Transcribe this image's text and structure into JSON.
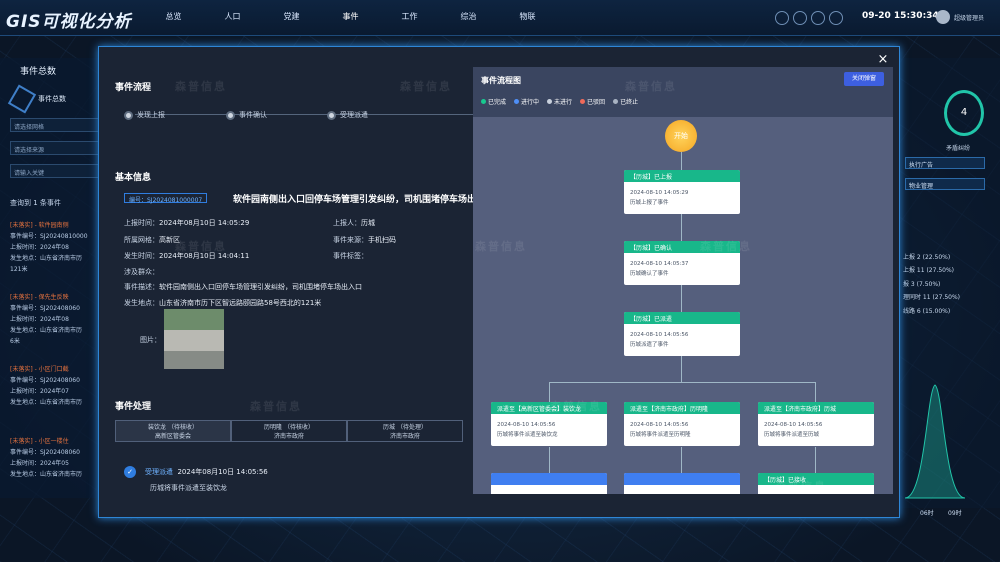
{
  "app": {
    "title": "GIS可视化分析"
  },
  "nav": [
    "总览",
    "人口",
    "党建",
    "事件",
    "工作",
    "综治",
    "物联"
  ],
  "header": {
    "clock": "09-20 15:30:34",
    "user": "超级管理员"
  },
  "left": {
    "title": "事件总数",
    "total_label": "事件总数",
    "filters": [
      "请选择网格",
      "请选择来源",
      "请输入关键"
    ],
    "count": "查询到 1 条事件",
    "events": [
      {
        "title": "[未落实] - 软件园南侧",
        "code": "事件编号：SJ20240810000",
        "time": "上报时间：2024年08",
        "addr": "发生地点：山东省济南市历",
        "extra": "121米"
      },
      {
        "title": "[未落实] - 保先生反映",
        "code": "事件编号：SJ202408060",
        "time": "上报时间：2024年08",
        "addr": "发生地点：山东省济南市历",
        "extra": "6米"
      },
      {
        "title": "[未落实] - 小区门口截",
        "code": "事件编号：SJ202408060",
        "time": "上报时间：2024年07",
        "addr": "发生地点：山东省济南市历",
        "extra": ""
      },
      {
        "title": "[未落实] - 小区一楼住",
        "code": "事件编号：SJ202408060",
        "time": "上报时间：2024年05",
        "addr": "发生地点：山东省济南市历",
        "extra": ""
      }
    ]
  },
  "right": {
    "gauge": "4",
    "gauge_label": "矛盾纠纷",
    "boxes": [
      "执行广告",
      "物业管理"
    ],
    "stats": [
      "上报 2 (22.50%)",
      "上报 11 (27.50%)",
      "报 3 (7.50%)",
      "理同时 11 (27.50%)",
      "线路 6 (15.00%)"
    ],
    "x_labels": [
      "06时",
      "09时"
    ]
  },
  "modal": {
    "close": "×",
    "process_title": "事件流程",
    "steps": [
      "发现上报",
      "事件确认",
      "受理派遣"
    ],
    "basic_title": "基本信息",
    "code": "编号：SJ2024081000007",
    "event_title": "软件园南侧出入口回停车场管理引发纠纷，司机围堵停车场出入",
    "info": {
      "report_time_label": "上报时间：",
      "report_time": "2024年08月10日 14:05:29",
      "reporter_label": "上报人：",
      "reporter": "历城",
      "grid_label": "所属网格：",
      "grid": "高新区",
      "source_label": "事件来源：",
      "source": "手机扫码",
      "occur_time_label": "发生时间：",
      "occur_time": "2024年08月10日 14:04:11",
      "tag_label": "事件标签：",
      "tag": "",
      "people_label": "涉及群众：",
      "people": "",
      "desc_label": "事件描述：",
      "desc": "软件园南侧出入口回停车场管理引发纠纷，司机围堵停车场出入口",
      "place_label": "发生地点：",
      "place": "山东省济南市历下区智远路颐园路58号西北的121米",
      "photo_label": "图片："
    },
    "handle_title": "事件处理",
    "tabs": [
      {
        "line1": "装饮龙 （待核收）",
        "line2": "高新区管委会"
      },
      {
        "line1": "历明隆 （待核收）",
        "line2": "济南市政府"
      },
      {
        "line1": "历城 （待处理）",
        "line2": "济南市政府"
      }
    ],
    "log": {
      "who": "受理派遣",
      "time": "2024年08月10日 14:05:56",
      "text": "历城将事件派遣至装饮龙"
    }
  },
  "flow": {
    "title": "事件流程图",
    "close_btn": "关闭弹窗",
    "legend": [
      {
        "label": "已完成",
        "color": "#18c98f"
      },
      {
        "label": "进行中",
        "color": "#4f8ff7"
      },
      {
        "label": "未进行",
        "color": "#c8d0dc"
      },
      {
        "label": "已驳回",
        "color": "#f06a5a"
      },
      {
        "label": "已终止",
        "color": "#a9b3c3"
      }
    ],
    "start": "开始",
    "nodes": [
      {
        "head": "【历城】已上报",
        "time": "2024-08-10 14:05:29",
        "text": "历城上报了事件"
      },
      {
        "head": "【历城】已确认",
        "time": "2024-08-10 14:05:37",
        "text": "历城确认了事件"
      },
      {
        "head": "【历城】已派遣",
        "time": "2024-08-10 14:05:56",
        "text": "历城派遣了事件"
      },
      {
        "head": "派遣至【高新区管委会】装饮龙",
        "time": "2024-08-10 14:05:56",
        "text": "历城将事件派遣至装饮龙"
      },
      {
        "head": "派遣至【济南市政府】历明隆",
        "time": "2024-08-10 14:05:56",
        "text": "历城将事件派遣至历明隆"
      },
      {
        "head": "派遣至【济南市政府】历城",
        "time": "2024-08-10 14:05:56",
        "text": "历城将事件派遣至历城"
      },
      {
        "head": "",
        "time": "",
        "text": ""
      },
      {
        "head": "",
        "time": "",
        "text": ""
      },
      {
        "head": "【历城】已接收",
        "time": "",
        "text": ""
      }
    ]
  },
  "watermark": "森普信息"
}
